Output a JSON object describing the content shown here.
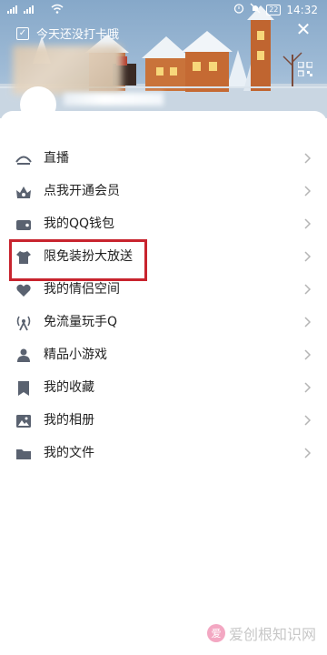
{
  "status_bar": {
    "carrier_left": "⁴⁶ᵢₗₗ ⁴⁶ᵢₗₗ",
    "battery": "22",
    "time": "14:32"
  },
  "header": {
    "checkin_text": "今天还没打卡哦",
    "close_icon": "close-icon",
    "qr_icon": "qr-code-icon"
  },
  "menu": {
    "items": [
      {
        "label": "直播",
        "icon": "live-icon"
      },
      {
        "label": "点我开通会员",
        "icon": "vip-icon"
      },
      {
        "label": "我的QQ钱包",
        "icon": "wallet-icon"
      },
      {
        "label": "限免装扮大放送",
        "icon": "shirt-icon"
      },
      {
        "label": "我的情侣空间",
        "icon": "couple-icon"
      },
      {
        "label": "免流量玩手Q",
        "icon": "signal-icon"
      },
      {
        "label": "精品小游戏",
        "icon": "game-icon"
      },
      {
        "label": "我的收藏",
        "icon": "bookmark-icon"
      },
      {
        "label": "我的相册",
        "icon": "album-icon"
      },
      {
        "label": "我的文件",
        "icon": "folder-icon"
      }
    ]
  },
  "watermark": {
    "logo": "爱",
    "text": "爱创根知识网"
  },
  "colors": {
    "icon": "#5a6270",
    "chevron": "#b5b5b5",
    "highlight": "#c8242e"
  }
}
